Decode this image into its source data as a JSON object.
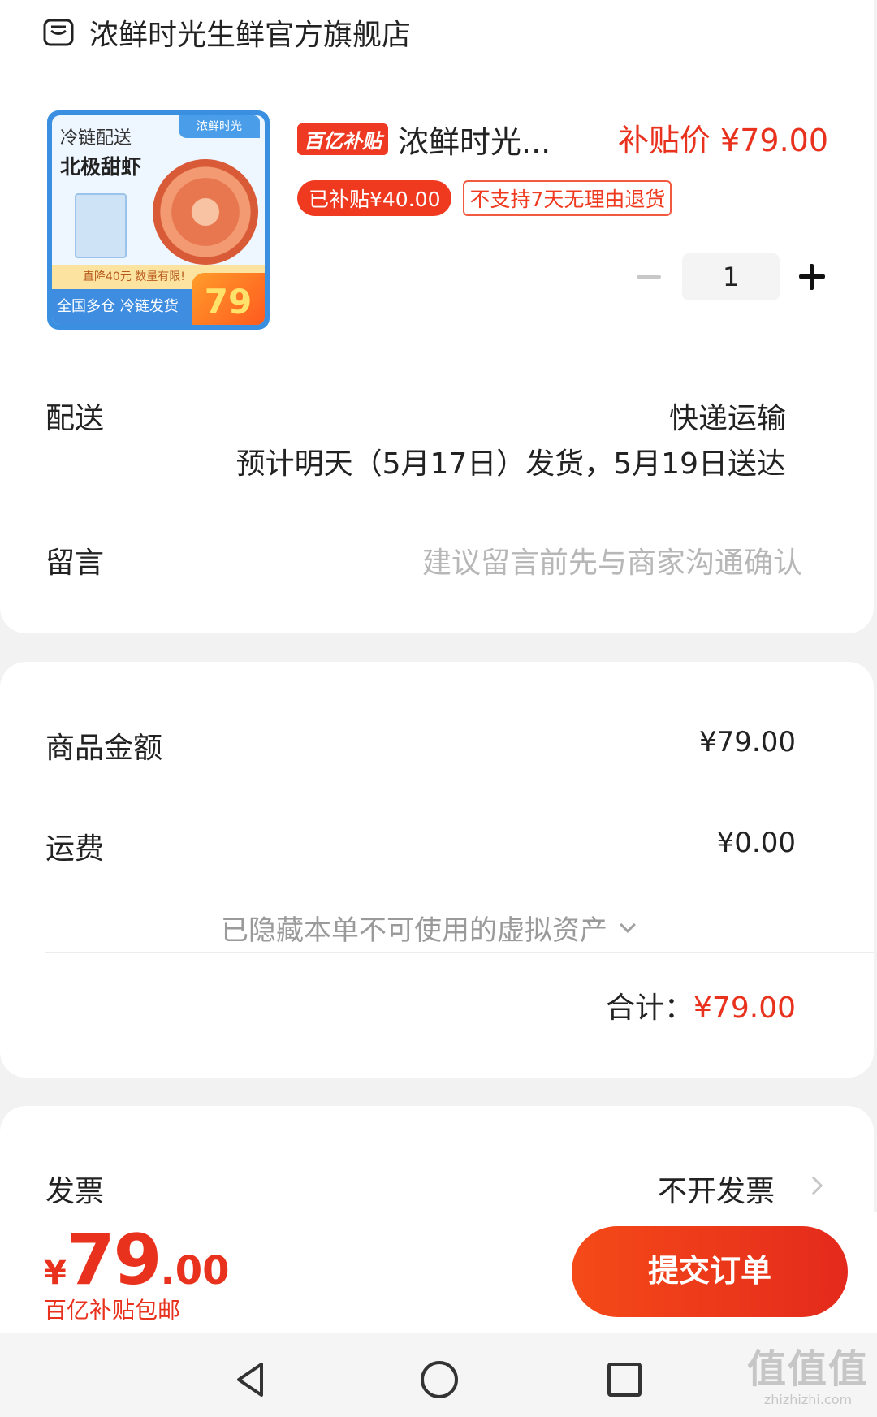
{
  "store": {
    "name": "浓鲜时光生鲜官方旗舰店",
    "icon": "store-icon"
  },
  "product": {
    "thumbnail": {
      "top_text": "冷链配送",
      "name_text": "北极甜虾",
      "logo_text": "浓鲜时光",
      "strip_text": "直降40元 数量有限!",
      "bottom_text": "全国多仓 冷链发货",
      "price_text": "79"
    },
    "subsidy_badge": "百亿补贴",
    "title": "浓鲜时光...",
    "subsidy_price": "补贴价 ¥79.00",
    "tags": [
      "已补贴¥40.00",
      "不支持7天无理由退货"
    ],
    "quantity": "1"
  },
  "delivery": {
    "label": "配送",
    "method": "快递运输",
    "eta": "预计明天（5月17日）发货，5月19日送达"
  },
  "message": {
    "label": "留言",
    "placeholder": "建议留言前先与商家沟通确认"
  },
  "amounts": {
    "goods_label": "商品金额",
    "goods_value": "¥79.00",
    "shipping_label": "运费",
    "shipping_value": "¥0.00",
    "hidden_assets": "已隐藏本单不可使用的虚拟资产",
    "total_label": "合计：",
    "total_value": "¥79.00"
  },
  "invoice": {
    "label": "发票",
    "value": "不开发票"
  },
  "bottom": {
    "currency": "¥",
    "price_int": "79",
    "price_dec": ".00",
    "note": "百亿补贴包邮",
    "submit_label": "提交订单"
  },
  "watermark": {
    "main": "值值值",
    "sub": "zhizhizhi.com"
  },
  "colors": {
    "accent": "#e8321e",
    "button": "#f54a18",
    "muted": "#b7b7b7"
  }
}
